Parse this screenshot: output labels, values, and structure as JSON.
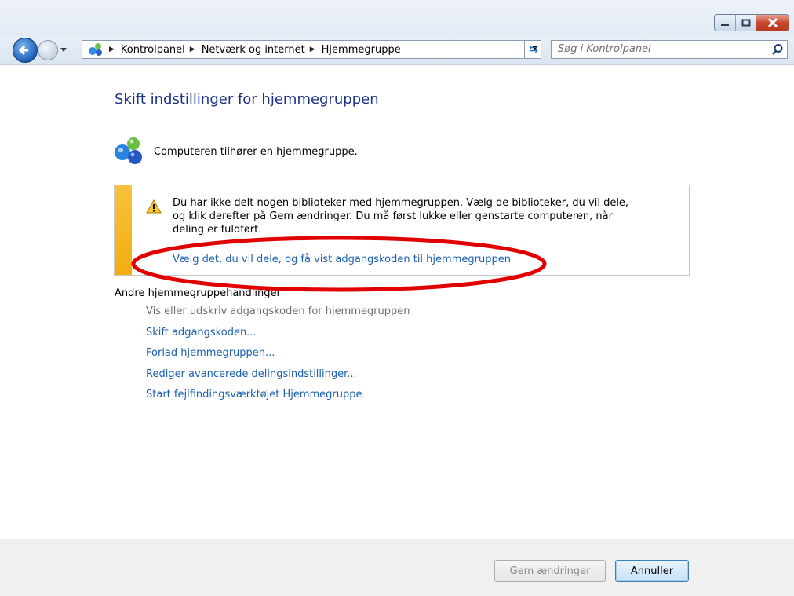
{
  "nav": {
    "breadcrumb": [
      "Kontrolpanel",
      "Netværk og internet",
      "Hjemmegruppe"
    ],
    "search_placeholder": "Søg i Kontrolpanel"
  },
  "page": {
    "title": "Skift indstillinger for hjemmegruppen",
    "status": "Computeren tilhører en hjemmegruppe."
  },
  "notice": {
    "text_lines": [
      "Du har ikke delt nogen biblioteker med hjemmegruppen. Vælg de biblioteker, du vil dele,",
      "og klik derefter på Gem ændringer. Du må først lukke eller genstarte computeren, når",
      "deling er fuldført."
    ],
    "link": "Vælg det, du vil dele, og få vist adgangskoden til hjemmegruppen"
  },
  "other_actions": {
    "label": "Andre hjemmegruppehandlinger",
    "items": [
      "Vis eller udskriv adgangskoden for hjemmegruppen",
      "Skift adgangskoden...",
      "Forlad hjemmegruppen...",
      "Rediger avancerede delingsindstillinger...",
      "Start fejlfindingsværktøjet Hjemmegruppe"
    ]
  },
  "footer": {
    "save_label": "Gem ændringer",
    "cancel_label": "Annuller"
  },
  "colors": {
    "link": "#1a5fb0",
    "title": "#1e3287",
    "warning_bar": "#f2ad13",
    "annotation": "#e00000"
  }
}
